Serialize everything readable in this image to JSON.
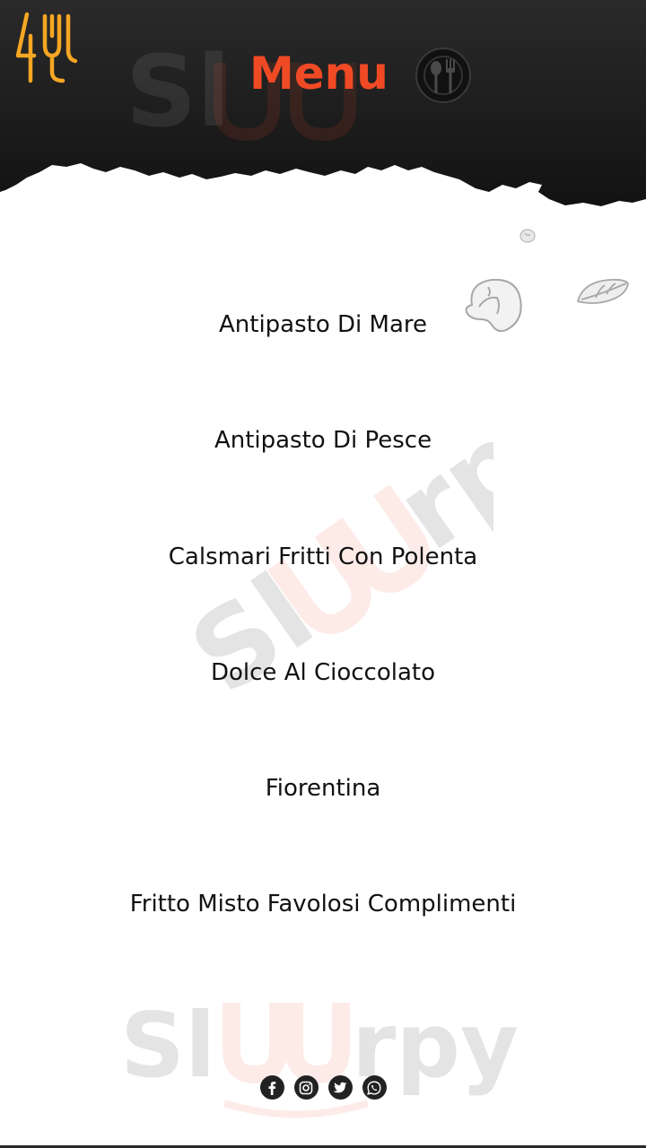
{
  "header": {
    "title": "Menu",
    "logo_icon": "fork-knife-logo-icon",
    "title_icon": "spoon-fork-plate-icon",
    "accent_color": "#f04a25",
    "logo_color": "#f5a623",
    "background_color": "#1e1e1e"
  },
  "menu": {
    "items": [
      {
        "label": "Antipasto Di Mare"
      },
      {
        "label": "Antipasto Di Pesce"
      },
      {
        "label": "Calsmari Fritti Con Polenta"
      },
      {
        "label": "Dolce Al Cioccolato"
      },
      {
        "label": "Fiorentina"
      },
      {
        "label": "Fritto Misto Favolosi Complimenti"
      }
    ]
  },
  "social": [
    {
      "icon": "facebook-icon"
    },
    {
      "icon": "instagram-icon"
    },
    {
      "icon": "twitter-icon"
    },
    {
      "icon": "whatsapp-icon"
    }
  ]
}
